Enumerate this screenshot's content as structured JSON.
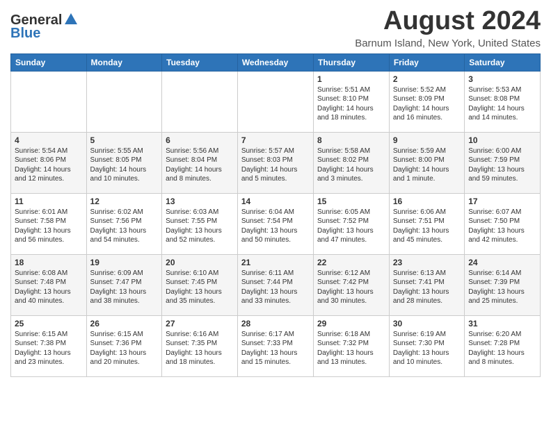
{
  "header": {
    "logo_general": "General",
    "logo_blue": "Blue",
    "month_year": "August 2024",
    "location": "Barnum Island, New York, United States"
  },
  "days_of_week": [
    "Sunday",
    "Monday",
    "Tuesday",
    "Wednesday",
    "Thursday",
    "Friday",
    "Saturday"
  ],
  "weeks": [
    [
      {
        "day": "",
        "data": ""
      },
      {
        "day": "",
        "data": ""
      },
      {
        "day": "",
        "data": ""
      },
      {
        "day": "",
        "data": ""
      },
      {
        "day": "1",
        "data": "Sunrise: 5:51 AM\nSunset: 8:10 PM\nDaylight: 14 hours and 18 minutes."
      },
      {
        "day": "2",
        "data": "Sunrise: 5:52 AM\nSunset: 8:09 PM\nDaylight: 14 hours and 16 minutes."
      },
      {
        "day": "3",
        "data": "Sunrise: 5:53 AM\nSunset: 8:08 PM\nDaylight: 14 hours and 14 minutes."
      }
    ],
    [
      {
        "day": "4",
        "data": "Sunrise: 5:54 AM\nSunset: 8:06 PM\nDaylight: 14 hours and 12 minutes."
      },
      {
        "day": "5",
        "data": "Sunrise: 5:55 AM\nSunset: 8:05 PM\nDaylight: 14 hours and 10 minutes."
      },
      {
        "day": "6",
        "data": "Sunrise: 5:56 AM\nSunset: 8:04 PM\nDaylight: 14 hours and 8 minutes."
      },
      {
        "day": "7",
        "data": "Sunrise: 5:57 AM\nSunset: 8:03 PM\nDaylight: 14 hours and 5 minutes."
      },
      {
        "day": "8",
        "data": "Sunrise: 5:58 AM\nSunset: 8:02 PM\nDaylight: 14 hours and 3 minutes."
      },
      {
        "day": "9",
        "data": "Sunrise: 5:59 AM\nSunset: 8:00 PM\nDaylight: 14 hours and 1 minute."
      },
      {
        "day": "10",
        "data": "Sunrise: 6:00 AM\nSunset: 7:59 PM\nDaylight: 13 hours and 59 minutes."
      }
    ],
    [
      {
        "day": "11",
        "data": "Sunrise: 6:01 AM\nSunset: 7:58 PM\nDaylight: 13 hours and 56 minutes."
      },
      {
        "day": "12",
        "data": "Sunrise: 6:02 AM\nSunset: 7:56 PM\nDaylight: 13 hours and 54 minutes."
      },
      {
        "day": "13",
        "data": "Sunrise: 6:03 AM\nSunset: 7:55 PM\nDaylight: 13 hours and 52 minutes."
      },
      {
        "day": "14",
        "data": "Sunrise: 6:04 AM\nSunset: 7:54 PM\nDaylight: 13 hours and 50 minutes."
      },
      {
        "day": "15",
        "data": "Sunrise: 6:05 AM\nSunset: 7:52 PM\nDaylight: 13 hours and 47 minutes."
      },
      {
        "day": "16",
        "data": "Sunrise: 6:06 AM\nSunset: 7:51 PM\nDaylight: 13 hours and 45 minutes."
      },
      {
        "day": "17",
        "data": "Sunrise: 6:07 AM\nSunset: 7:50 PM\nDaylight: 13 hours and 42 minutes."
      }
    ],
    [
      {
        "day": "18",
        "data": "Sunrise: 6:08 AM\nSunset: 7:48 PM\nDaylight: 13 hours and 40 minutes."
      },
      {
        "day": "19",
        "data": "Sunrise: 6:09 AM\nSunset: 7:47 PM\nDaylight: 13 hours and 38 minutes."
      },
      {
        "day": "20",
        "data": "Sunrise: 6:10 AM\nSunset: 7:45 PM\nDaylight: 13 hours and 35 minutes."
      },
      {
        "day": "21",
        "data": "Sunrise: 6:11 AM\nSunset: 7:44 PM\nDaylight: 13 hours and 33 minutes."
      },
      {
        "day": "22",
        "data": "Sunrise: 6:12 AM\nSunset: 7:42 PM\nDaylight: 13 hours and 30 minutes."
      },
      {
        "day": "23",
        "data": "Sunrise: 6:13 AM\nSunset: 7:41 PM\nDaylight: 13 hours and 28 minutes."
      },
      {
        "day": "24",
        "data": "Sunrise: 6:14 AM\nSunset: 7:39 PM\nDaylight: 13 hours and 25 minutes."
      }
    ],
    [
      {
        "day": "25",
        "data": "Sunrise: 6:15 AM\nSunset: 7:38 PM\nDaylight: 13 hours and 23 minutes."
      },
      {
        "day": "26",
        "data": "Sunrise: 6:15 AM\nSunset: 7:36 PM\nDaylight: 13 hours and 20 minutes."
      },
      {
        "day": "27",
        "data": "Sunrise: 6:16 AM\nSunset: 7:35 PM\nDaylight: 13 hours and 18 minutes."
      },
      {
        "day": "28",
        "data": "Sunrise: 6:17 AM\nSunset: 7:33 PM\nDaylight: 13 hours and 15 minutes."
      },
      {
        "day": "29",
        "data": "Sunrise: 6:18 AM\nSunset: 7:32 PM\nDaylight: 13 hours and 13 minutes."
      },
      {
        "day": "30",
        "data": "Sunrise: 6:19 AM\nSunset: 7:30 PM\nDaylight: 13 hours and 10 minutes."
      },
      {
        "day": "31",
        "data": "Sunrise: 6:20 AM\nSunset: 7:28 PM\nDaylight: 13 hours and 8 minutes."
      }
    ]
  ]
}
